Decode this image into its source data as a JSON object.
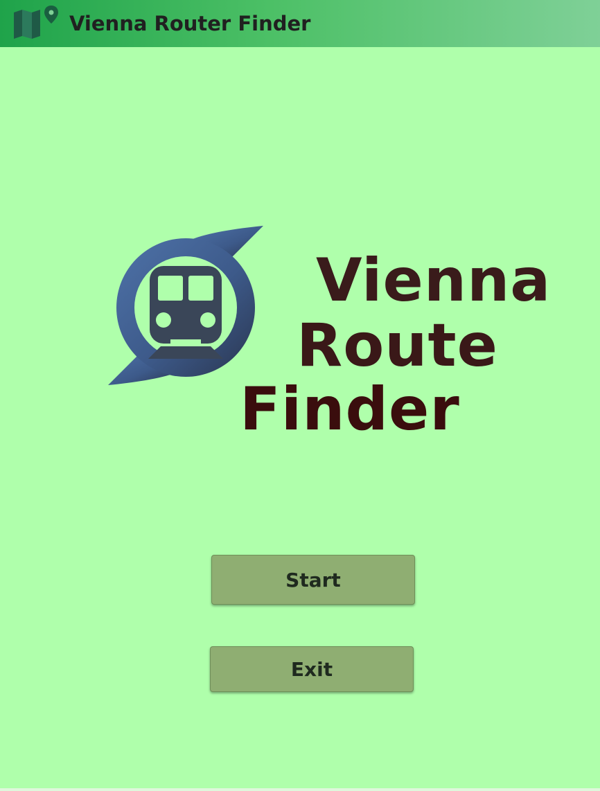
{
  "header": {
    "title": "Vienna Router Finder",
    "icon": "map-pin-icon"
  },
  "logo": {
    "icon": "train-icon",
    "word1": "Vienna",
    "word2": "Route",
    "word3": "Finder"
  },
  "actions": {
    "start_label": "Start",
    "exit_label": "Exit"
  },
  "colors": {
    "background": "#afffab",
    "header_start": "#1fa34a",
    "header_end": "#7fd097",
    "button": "#8fae72",
    "logo_blue": "#4a6aa0",
    "logo_dark": "#2e3a52",
    "logo_text": "#3a1b1b"
  }
}
